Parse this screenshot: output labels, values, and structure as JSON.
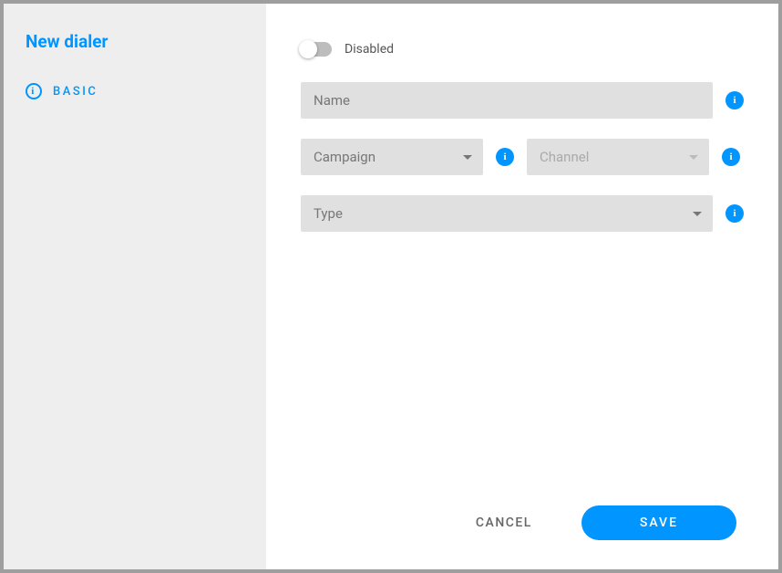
{
  "sidebar": {
    "title": "New dialer",
    "item_label": "BASIC"
  },
  "form": {
    "toggle_label": "Disabled",
    "name_placeholder": "Name",
    "campaign_label": "Campaign",
    "channel_label": "Channel",
    "type_label": "Type"
  },
  "actions": {
    "cancel": "CANCEL",
    "save": "SAVE"
  }
}
